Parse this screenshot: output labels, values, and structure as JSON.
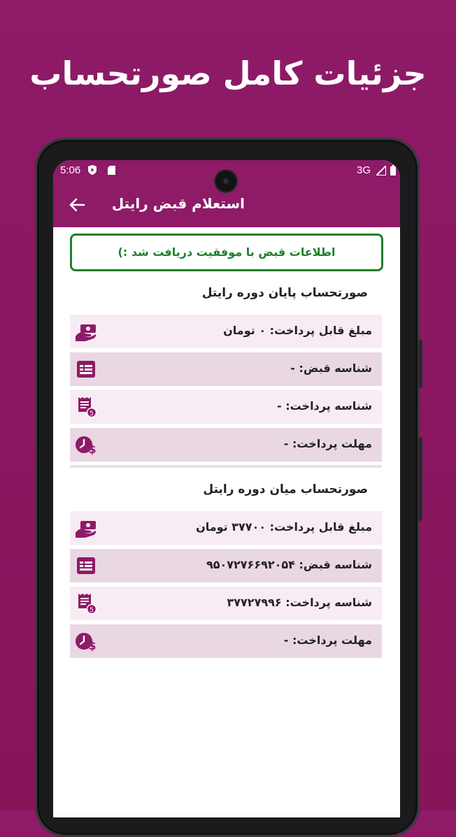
{
  "banner": {
    "headline": "جزئیات کامل صورتحساب"
  },
  "status_bar": {
    "time": "5:06",
    "network": "3G"
  },
  "app_bar": {
    "title": "استعلام قبض رایتل"
  },
  "success_message": "اطلاعات قبض با موفقیت دریافت شد :)",
  "sections": [
    {
      "title": "صورتحساب پایان دوره رایتل",
      "rows": [
        {
          "label": "مبلغ قابل پرداخت: ۰ تومان",
          "icon": "money-hand-icon"
        },
        {
          "label": "شناسه قبض: -",
          "icon": "bill-card-icon"
        },
        {
          "label": "شناسه پرداخت: -",
          "icon": "receipt-icon"
        },
        {
          "label": "مهلت پرداخت: -",
          "icon": "clock-dollar-icon"
        }
      ]
    },
    {
      "title": "صورتحساب میان دوره رایتل",
      "rows": [
        {
          "label": "مبلغ قابل پرداخت: ۳۷۷۰۰ تومان",
          "icon": "money-hand-icon"
        },
        {
          "label": "شناسه قبض: ۹۵۰۷۲۷۶۶۹۲۰۵۴",
          "icon": "bill-card-icon"
        },
        {
          "label": "شناسه پرداخت: ۳۷۷۲۷۹۹۶",
          "icon": "receipt-icon"
        },
        {
          "label": "مهلت پرداخت: -",
          "icon": "clock-dollar-icon"
        }
      ]
    }
  ],
  "colors": {
    "brand": "#8e1a68",
    "success": "#1e7f2a",
    "row_light": "#f7ecf3",
    "row_dark": "#e9d8e3"
  }
}
